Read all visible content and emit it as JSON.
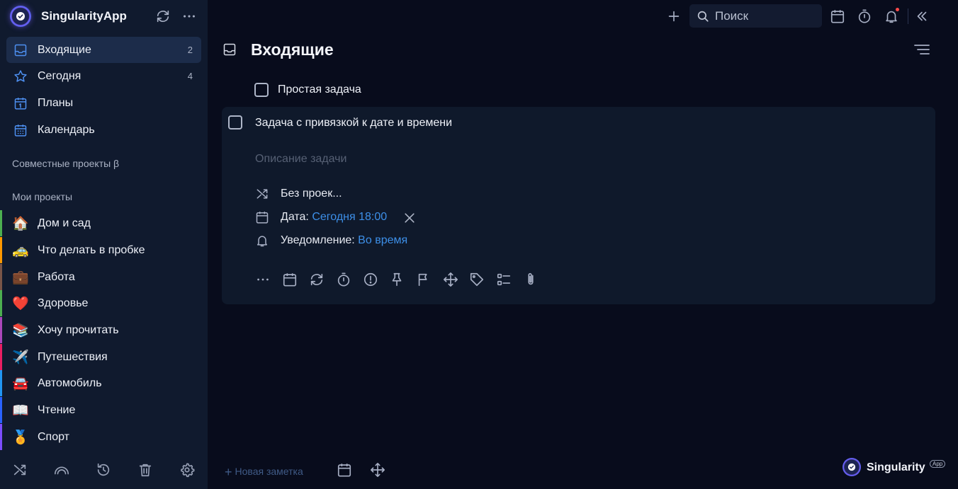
{
  "app": {
    "title": "SingularityApp"
  },
  "sidebar": {
    "nav": [
      {
        "label": "Входящие",
        "count": "2",
        "icon": "inbox-icon"
      },
      {
        "label": "Сегодня",
        "count": "4",
        "icon": "star-icon"
      },
      {
        "label": "Планы",
        "count": "",
        "icon": "calendar-day-icon"
      },
      {
        "label": "Календарь",
        "count": "",
        "icon": "calendar-grid-icon"
      }
    ],
    "shared_projects_title": "Совместные проекты β",
    "my_projects_title": "Мои проекты",
    "projects": [
      {
        "emoji": "🏠",
        "label": "Дом и сад",
        "color": "#4caf50"
      },
      {
        "emoji": "🚕",
        "label": "Что делать в пробке",
        "color": "#ff9800"
      },
      {
        "emoji": "💼",
        "label": "Работа",
        "color": "#795548"
      },
      {
        "emoji": "❤️",
        "label": "Здоровье",
        "color": "#4caf50"
      },
      {
        "emoji": "📚",
        "label": "Хочу прочитать",
        "color": "#ab47bc"
      },
      {
        "emoji": "✈️",
        "label": "Путешествия",
        "color": "#e91e63"
      },
      {
        "emoji": "🚘",
        "label": "Автомобиль",
        "color": "#2196f3"
      },
      {
        "emoji": "📖",
        "label": "Чтение",
        "color": "#2962ff"
      },
      {
        "emoji": "🏅",
        "label": "Спорт",
        "color": "#7c4dff"
      }
    ]
  },
  "topbar": {
    "search_placeholder": "Поиск"
  },
  "page": {
    "title": "Входящие"
  },
  "tasks": {
    "simple": {
      "title": "Простая задача"
    },
    "detailed": {
      "title": "Задача с привязкой к дате и времени",
      "description_placeholder": "Описание задачи",
      "project": "Без проек...",
      "date_label": "Дата:",
      "date_value": "Сегодня 18:00",
      "notification_label": "Уведомление:",
      "notification_value": "Во время"
    }
  },
  "bottom": {
    "new_note": "Новая заметка",
    "brand": "Singularity",
    "brand_badge": "App"
  },
  "colors": {
    "accent": "#3d8fe8",
    "sidebar_bg": "#101a2e",
    "main_bg": "#080c1c"
  }
}
